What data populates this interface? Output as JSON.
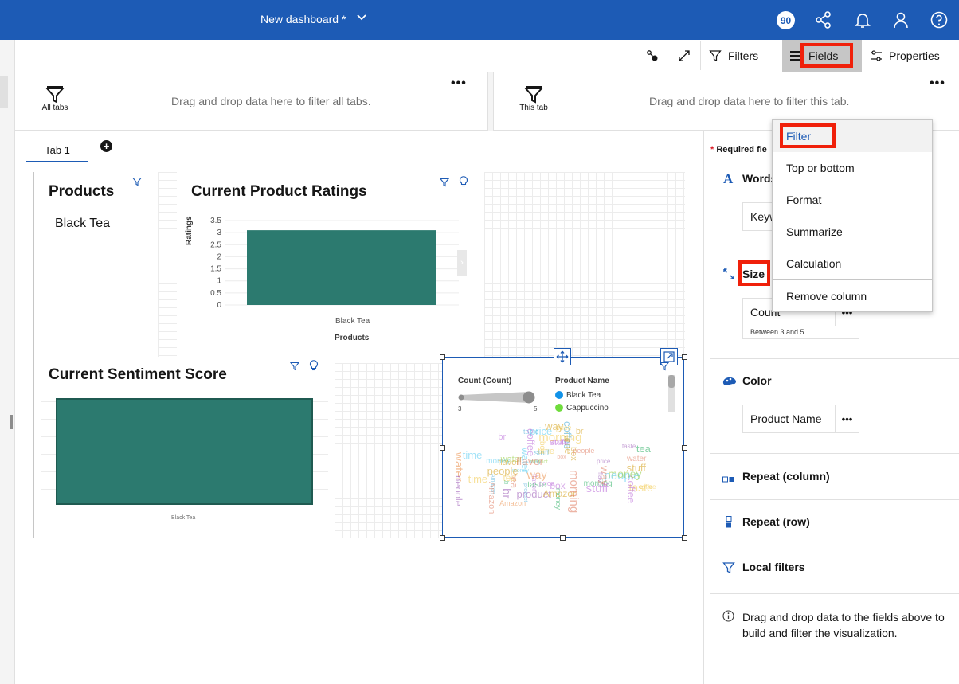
{
  "header": {
    "title": "New dashboard *",
    "badge_count": "90"
  },
  "toolbar": {
    "filters_label": "Filters",
    "fields_label": "Fields",
    "properties_label": "Properties"
  },
  "filter_zones": {
    "all_tabs_label": "All tabs",
    "all_tabs_hint": "Drag and drop data here to filter all tabs.",
    "this_tab_label": "This tab",
    "this_tab_hint": "Drag and drop data here to filter this tab.",
    "more_label": "•••"
  },
  "tabs": [
    {
      "label": "Tab 1"
    }
  ],
  "widgets": {
    "products": {
      "title": "Products",
      "value": "Black Tea"
    },
    "ratings": {
      "title": "Current Product Ratings",
      "ylabel": "Ratings",
      "xlabel": "Products",
      "y_ticks": [
        "3.5",
        "3",
        "2.5",
        "2",
        "1.5",
        "1",
        "0.5",
        "0"
      ],
      "category": "Black Tea"
    },
    "sentiment": {
      "title": "Current Sentiment Score",
      "category": "Black Tea"
    },
    "wordcloud": {
      "legend_size_title": "Count (Count)",
      "legend_size_min": "3",
      "legend_size_max": "5",
      "legend_color_title": "Product Name",
      "legend_items": [
        {
          "label": "Black Tea",
          "color": "#1192e8"
        },
        {
          "label": "Cappuccino",
          "color": "#6fdc3c"
        }
      ],
      "words": [
        "way",
        "taste",
        "br",
        "time",
        "coffee",
        "price",
        "box",
        "water",
        "flavor",
        "money",
        "stuff",
        "people",
        "product",
        "Amazon",
        "morning",
        "tea"
      ]
    }
  },
  "chart_data": [
    {
      "type": "bar",
      "title": "Current Product Ratings",
      "xlabel": "Products",
      "ylabel": "Ratings",
      "categories": [
        "Black Tea"
      ],
      "values": [
        3.1
      ],
      "ylim": [
        0,
        3.5
      ]
    },
    {
      "type": "bar",
      "title": "Current Sentiment Score",
      "categories": [
        "Black Tea"
      ],
      "values": [
        1
      ]
    }
  ],
  "fields_panel": {
    "required_label": "Required fie",
    "words_label": "Words",
    "words_value": "Keyw",
    "size_label": "Size",
    "size_value": "Count",
    "size_filter_note": "Between 3 and 5",
    "color_label": "Color",
    "color_value": "Product Name",
    "repeat_column_label": "Repeat (column)",
    "repeat_row_label": "Repeat (row)",
    "local_filters_label": "Local filters",
    "info_text_line1": "Drag and drop data to the fields above to",
    "info_text_line2": "build and filter the visualization.",
    "dots": "•••"
  },
  "context_menu": {
    "items": [
      "Filter",
      "Top or bottom",
      "Format",
      "Summarize",
      "Calculation",
      "Remove column"
    ]
  },
  "colors": {
    "header_blue": "#1d5bb5",
    "bar_teal": "#2c7a6f",
    "highlight_red": "#f0200a",
    "link_blue": "#1d5bb5"
  }
}
